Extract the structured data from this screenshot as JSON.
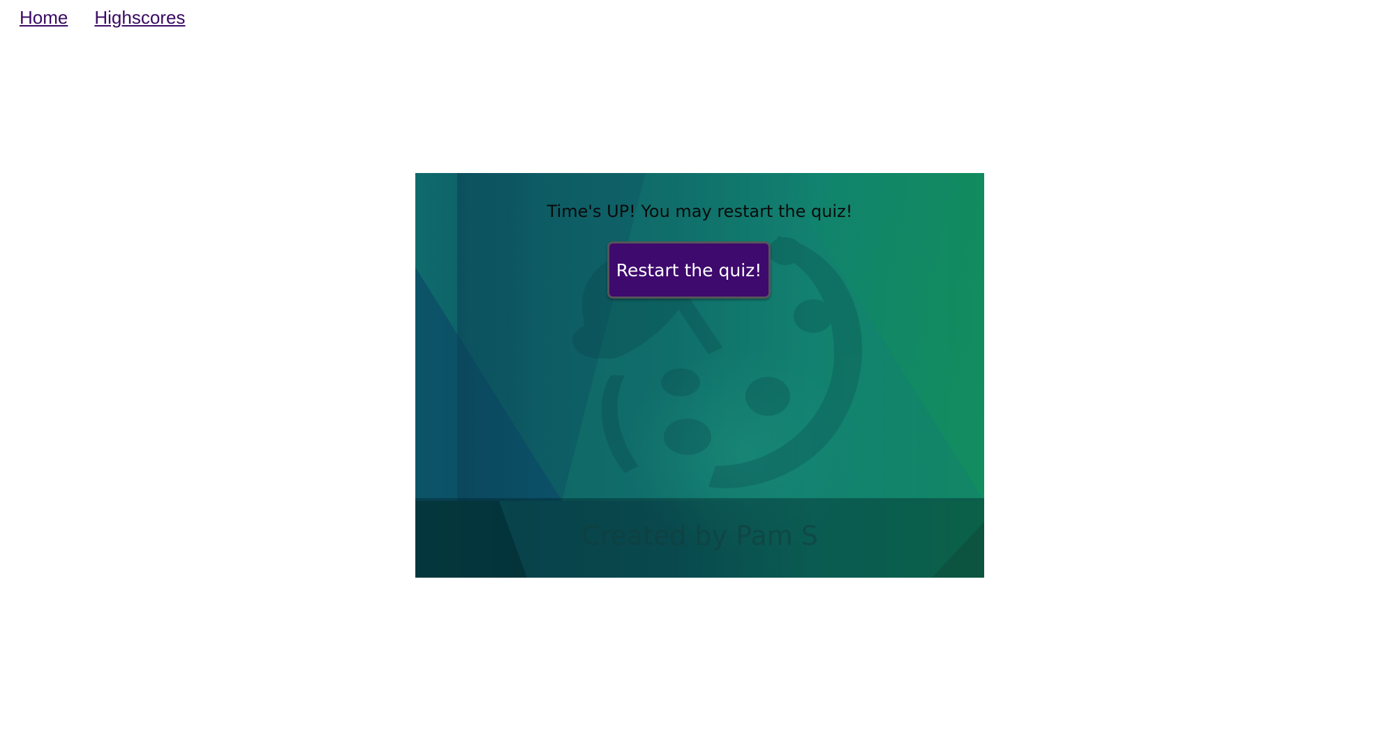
{
  "nav": {
    "home_label": "Home",
    "highscores_label": "Highscores"
  },
  "quiz": {
    "message": "Time's UP! You may restart the quiz!",
    "restart_label": "Restart the quiz!"
  },
  "footer": {
    "credit": "Created by Pam S"
  },
  "colors": {
    "link": "#3a0a63",
    "button_bg": "#3e0a6e",
    "button_text": "#ffffff",
    "panel_teal": "#0f6468",
    "panel_green": "#128a60"
  },
  "icons": {
    "background": "paint-palette-icon"
  }
}
